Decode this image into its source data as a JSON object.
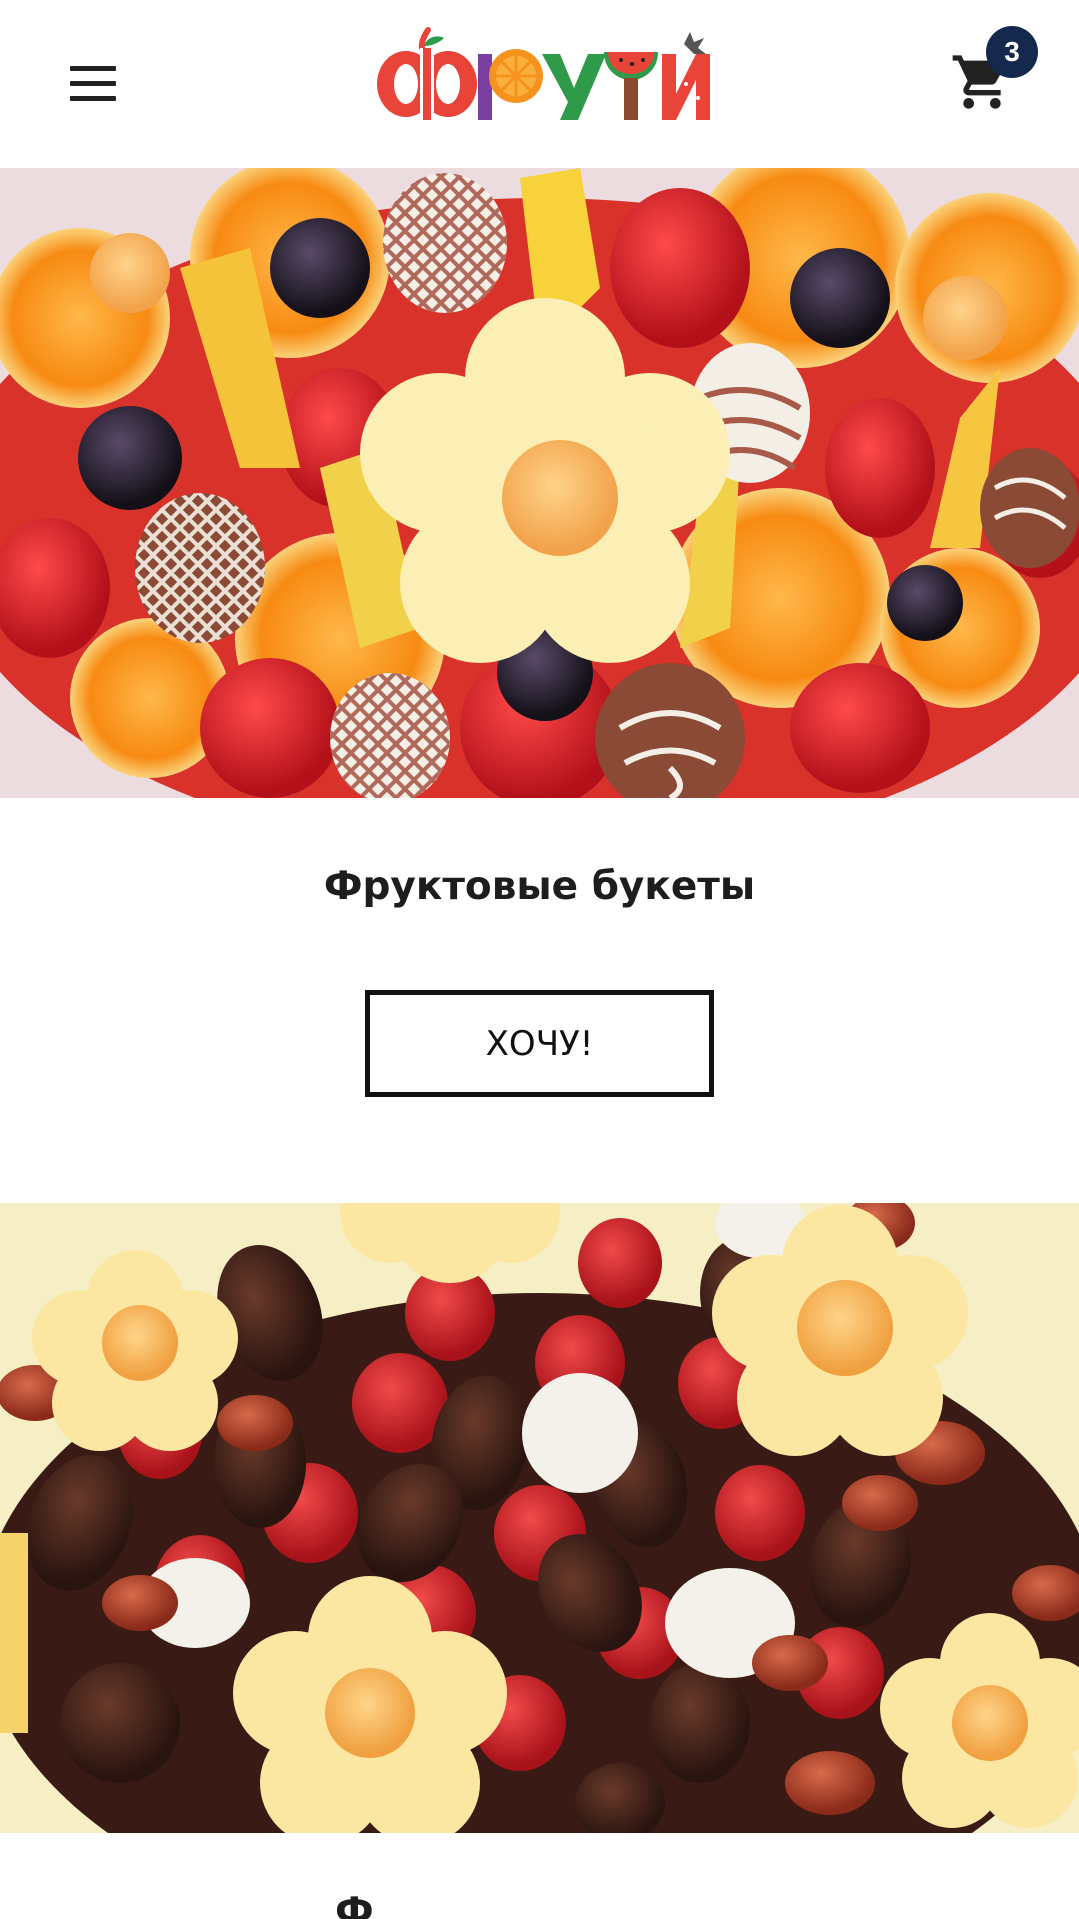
{
  "header": {
    "logo_text": "ФРУТИ",
    "cart_count": "3",
    "icons": {
      "menu": "hamburger-menu-icon",
      "cart": "shopping-cart-icon"
    }
  },
  "sections": [
    {
      "title": "Фруктовые букеты",
      "button_label": "ХОЧУ!"
    },
    {
      "title": "Ф"
    }
  ],
  "colors": {
    "badge": "#15284e",
    "logo_red": "#e9443a",
    "logo_orange": "#f6931e",
    "logo_purple": "#7b3fa0",
    "logo_green": "#2e9a4a",
    "hero1_bg": "#ecdce0",
    "hero2_bg": "#f6efc5"
  }
}
